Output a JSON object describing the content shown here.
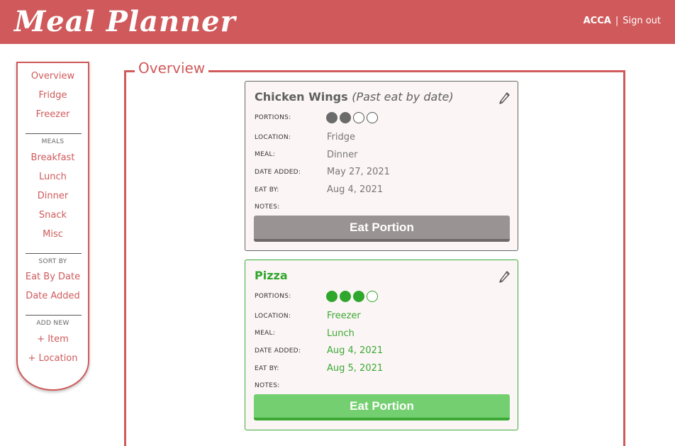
{
  "header": {
    "logo": "Meal Planner",
    "user": "ACCA",
    "separator": "|",
    "sign_out": "Sign out"
  },
  "sidebar": {
    "views": [
      "Overview",
      "Fridge",
      "Freezer"
    ],
    "meals_heading": "MEALS",
    "meals": [
      "Breakfast",
      "Lunch",
      "Dinner",
      "Snack",
      "Misc"
    ],
    "sort_heading": "SORT BY",
    "sort": [
      "Eat By Date",
      "Date Added"
    ],
    "add_heading": "ADD NEW",
    "add": [
      "+ Item",
      "+ Location"
    ]
  },
  "main": {
    "title": "Overview"
  },
  "labels": {
    "portions": "PORTIONS:",
    "location": "LOCATION:",
    "meal": "MEAL:",
    "date_added": "DATE ADDED:",
    "eat_by": "EAT BY:",
    "notes": "NOTES:"
  },
  "items": [
    {
      "name": "Chicken Wings",
      "note": "(Past eat by date)",
      "portions_filled": 2,
      "portions_total": 4,
      "location": "Fridge",
      "meal": "Dinner",
      "date_added": "May 27, 2021",
      "eat_by": "Aug 4, 2021",
      "notes": "",
      "button": "Eat Portion",
      "status_color": "#9a9393"
    },
    {
      "name": "Pizza",
      "note": "",
      "portions_filled": 3,
      "portions_total": 4,
      "location": "Freezer",
      "meal": "Lunch",
      "date_added": "Aug 4, 2021",
      "eat_by": "Aug 5, 2021",
      "notes": "",
      "button": "Eat Portion",
      "status_color": "#74cf70"
    }
  ],
  "icons": {
    "edit": "pencil-icon"
  },
  "colors": {
    "brand": "#d05a5b",
    "expired": "#6b6b6b",
    "fresh": "#2fa62c"
  }
}
